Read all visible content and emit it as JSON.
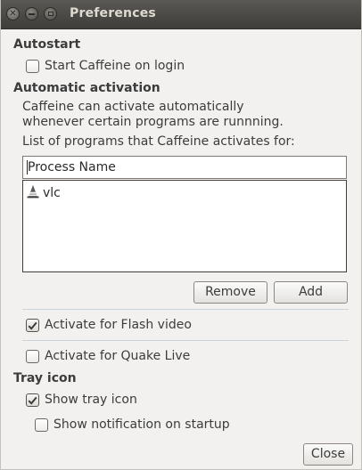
{
  "window": {
    "title": "Preferences"
  },
  "autostart": {
    "heading": "Autostart",
    "start_on_login": {
      "label": "Start Caffeine on login",
      "checked": false
    }
  },
  "activation": {
    "heading": "Automatic activation",
    "description_line1": "Caffeine can activate automatically",
    "description_line2": "whenever certain programs are runnning.",
    "list_caption": "List of programs that Caffeine activates for:",
    "column_header": "Process Name",
    "programs": [
      {
        "name": "vlc",
        "icon": "vlc-cone-icon"
      }
    ],
    "remove_label": "Remove",
    "add_label": "Add",
    "flash": {
      "label": "Activate for Flash video",
      "checked": true
    },
    "quake": {
      "label": "Activate for Quake Live",
      "checked": false
    }
  },
  "tray": {
    "heading": "Tray icon",
    "show_tray_icon": {
      "label": "Show tray icon",
      "checked": true
    },
    "show_notification": {
      "label": "Show notification on startup",
      "checked": false
    }
  },
  "footer": {
    "close_label": "Close"
  },
  "colors": {
    "titlebar": "#4a4945",
    "window_bg": "#f2f1f0",
    "separator": "#c9d3dc"
  }
}
